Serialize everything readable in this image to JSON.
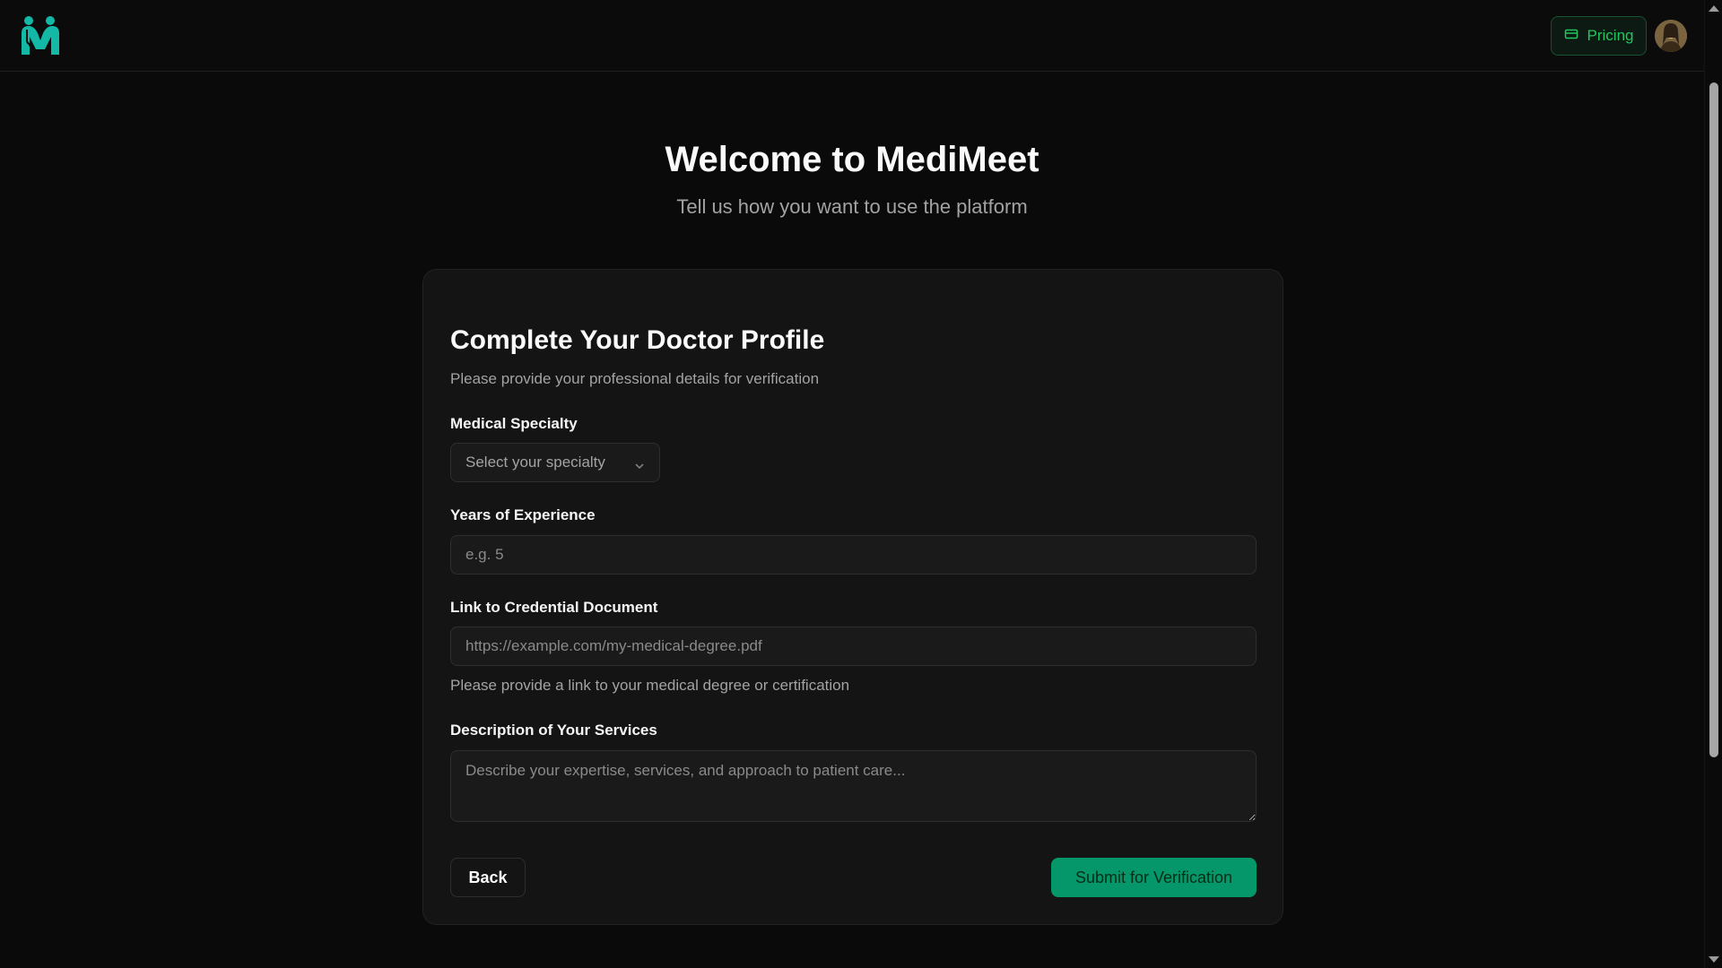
{
  "header": {
    "logo_icon": "medimeet-logo-icon",
    "pricing_label": "Pricing",
    "pricing_icon": "credit-card-icon",
    "avatar_icon": "user-avatar"
  },
  "hero": {
    "title": "Welcome to MediMeet",
    "subtitle": "Tell us how you want to use the platform"
  },
  "form": {
    "title": "Complete Your Doctor Profile",
    "description": "Please provide your professional details for verification",
    "specialty": {
      "label": "Medical Specialty",
      "placeholder": "Select your specialty",
      "icon": "chevron-down-icon"
    },
    "experience": {
      "label": "Years of Experience",
      "placeholder": "e.g. 5",
      "value": ""
    },
    "credential": {
      "label": "Link to Credential Document",
      "placeholder": "https://example.com/my-medical-degree.pdf",
      "value": "",
      "hint": "Please provide a link to your medical degree or certification"
    },
    "description_field": {
      "label": "Description of Your Services",
      "placeholder": "Describe your expertise, services, and approach to patient care...",
      "value": ""
    },
    "back_label": "Back",
    "submit_label": "Submit for Verification"
  },
  "colors": {
    "background": "#0a0a0a",
    "card": "#141414",
    "accent": "#059669",
    "accent_text": "#22c55e",
    "logo": "#14b8a6"
  }
}
